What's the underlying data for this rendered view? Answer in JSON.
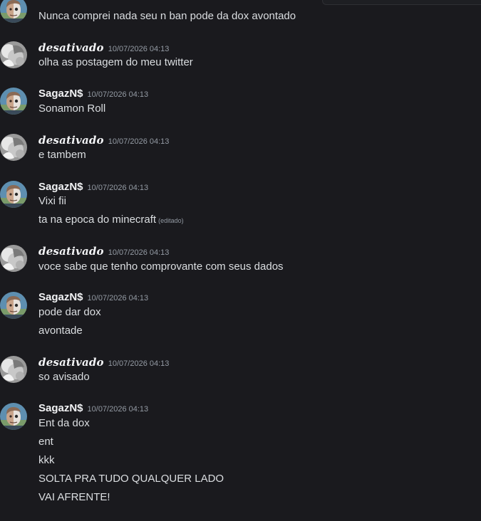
{
  "users": {
    "desativado": "desativado",
    "sagaz": "SagazN$"
  },
  "timestamp": "10/07/2026 04:13",
  "edited_label": "(editado)",
  "colors": {
    "background": "#1a1a1e",
    "text": "#dbdee1",
    "username": "#f2f3f5",
    "muted": "#949ba4"
  },
  "messages": [
    {
      "author": "",
      "lines": [
        "Nunca comprei nada seu n ban pode da dox avontado"
      ]
    },
    {
      "author": "desativado",
      "lines": [
        "olha as postagem do meu twitter"
      ]
    },
    {
      "author": "SagazN$",
      "lines": [
        "Sonamon Roll"
      ]
    },
    {
      "author": "desativado",
      "lines": [
        "e tambem"
      ]
    },
    {
      "author": "SagazN$",
      "lines": [
        "Vixi fii",
        "ta na epoca do minecraft"
      ]
    },
    {
      "author": "desativado",
      "lines": [
        "voce sabe que tenho comprovante com seus dados"
      ]
    },
    {
      "author": "SagazN$",
      "lines": [
        "pode dar dox",
        "avontade"
      ]
    },
    {
      "author": "desativado",
      "lines": [
        "so avisado"
      ]
    },
    {
      "author": "SagazN$",
      "lines": [
        "Ent da dox",
        "ent",
        "kkk",
        "SOLTA PRA TUDO QUALQUER LADO",
        "VAI AFRENTE!"
      ]
    }
  ]
}
